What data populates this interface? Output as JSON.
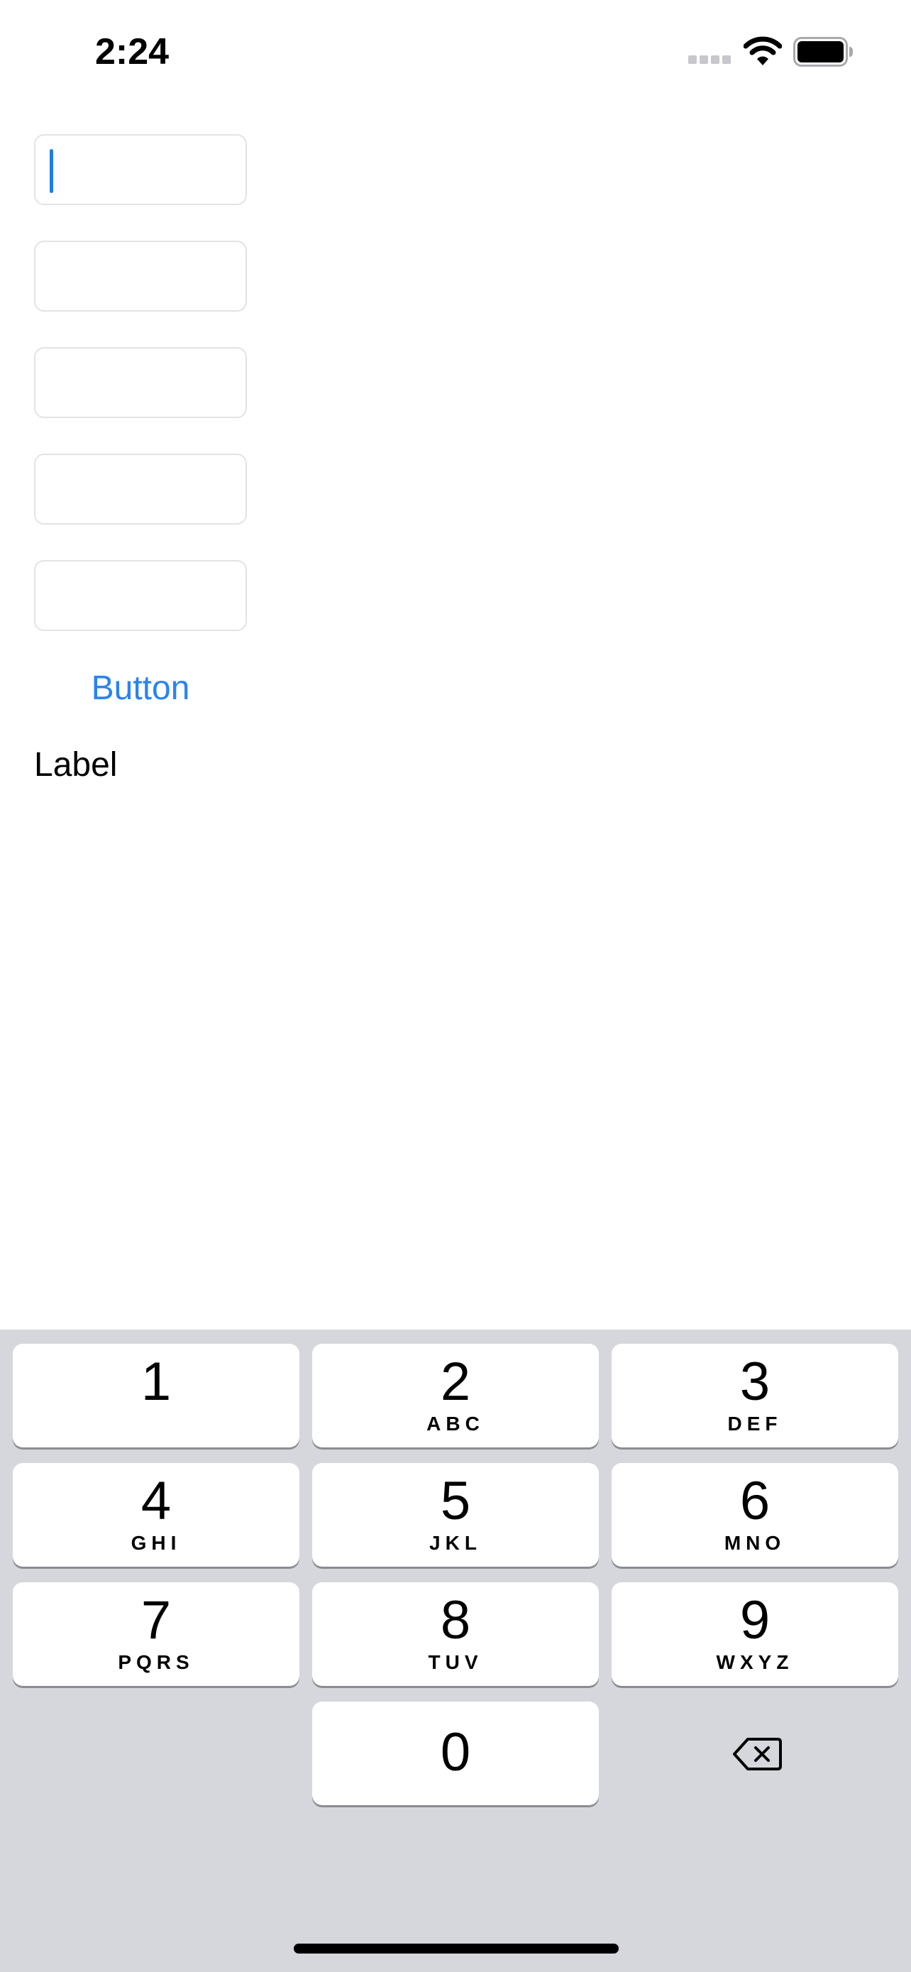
{
  "status_bar": {
    "time": "2:24",
    "signal_icon": "cellular-signal-icon",
    "wifi_icon": "wifi-icon",
    "battery_icon": "battery-icon"
  },
  "form": {
    "fields": [
      {
        "value": "",
        "focused": true
      },
      {
        "value": "",
        "focused": false
      },
      {
        "value": "",
        "focused": false
      },
      {
        "value": "",
        "focused": false
      },
      {
        "value": "",
        "focused": false
      }
    ],
    "button_label": "Button",
    "label_text": "Label",
    "accent_color": "#2a83f0"
  },
  "keyboard": {
    "keys": [
      {
        "digit": "1",
        "letters": ""
      },
      {
        "digit": "2",
        "letters": "ABC"
      },
      {
        "digit": "3",
        "letters": "DEF"
      },
      {
        "digit": "4",
        "letters": "GHI"
      },
      {
        "digit": "5",
        "letters": "JKL"
      },
      {
        "digit": "6",
        "letters": "MNO"
      },
      {
        "digit": "7",
        "letters": "PQRS"
      },
      {
        "digit": "8",
        "letters": "TUV"
      },
      {
        "digit": "9",
        "letters": "WXYZ"
      },
      {
        "digit": "0",
        "letters": ""
      }
    ],
    "delete_icon": "delete-backspace-icon",
    "background_color": "#d6d7dc"
  }
}
